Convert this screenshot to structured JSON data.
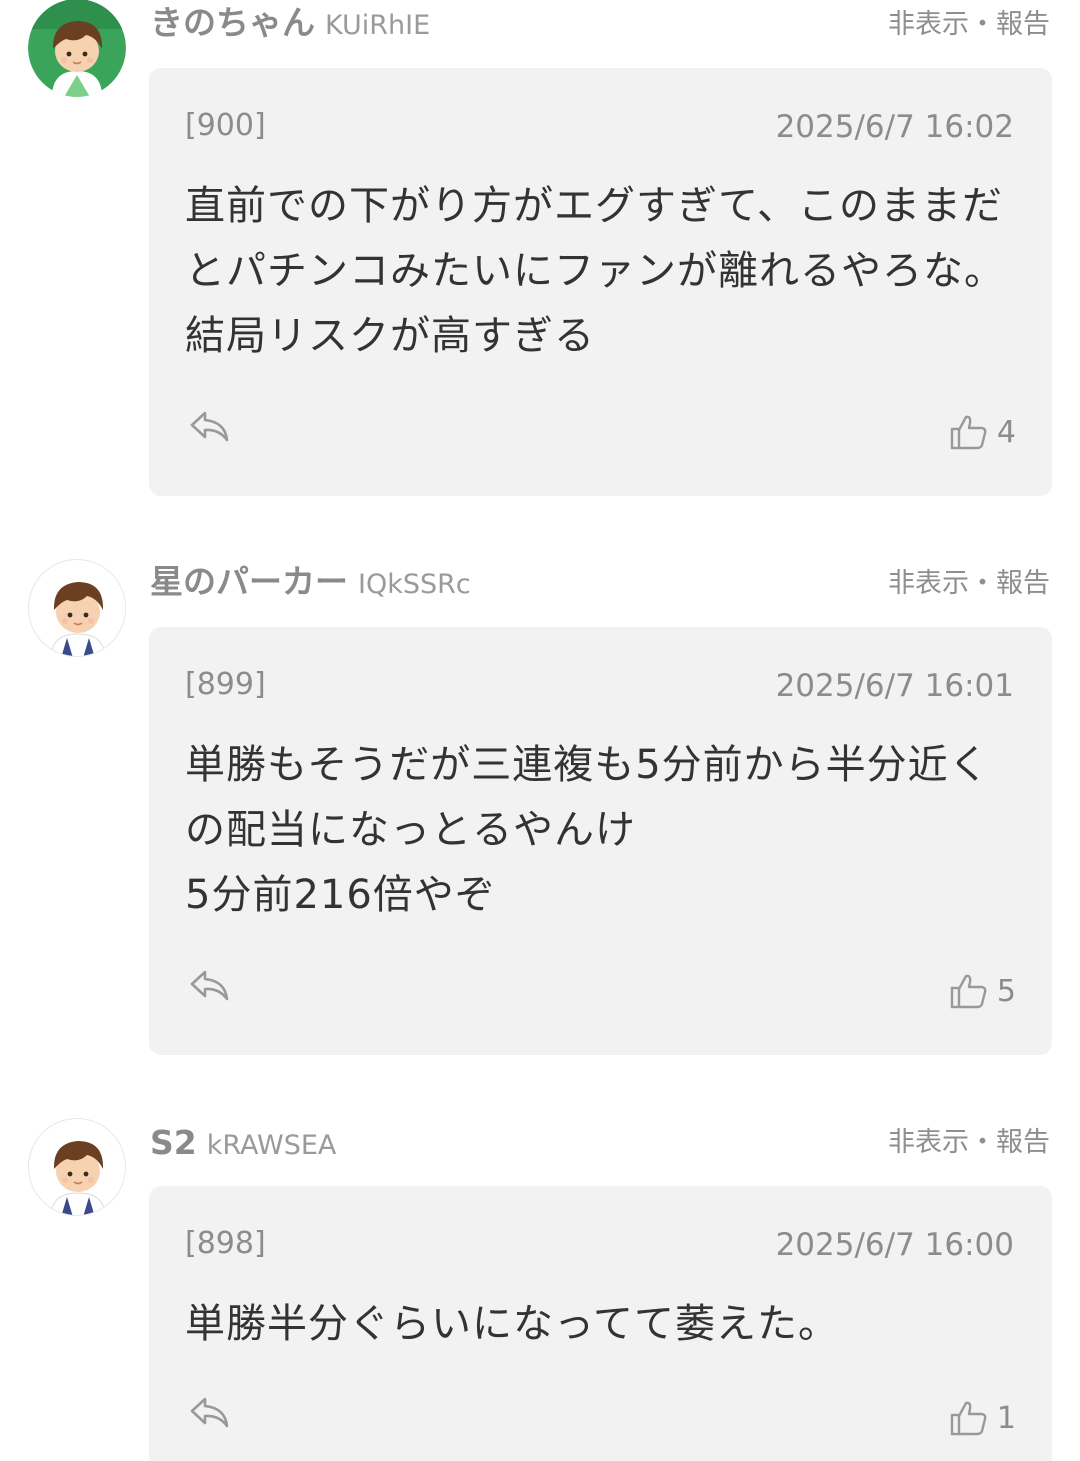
{
  "comments": [
    {
      "name": "きのちゃん",
      "uid": "KUiRhIE",
      "action": "非表示・報告",
      "number": "[900]",
      "date": "2025/6/7 16:02",
      "text": "直前での下がり方がエグすぎて、このままだとパチンコみたいにファンが離れるやろな。結局リスクが高すぎる",
      "likes": "4",
      "avatar_icon": "boy-avatar-icon-green-background"
    },
    {
      "name": "星のパーカー",
      "uid": "IQkSSRc",
      "action": "非表示・報告",
      "number": "[899]",
      "date": "2025/6/7 16:01",
      "text": "単勝もそうだが三連複も5分前から半分近くの配当になっとるやんけ\n5分前216倍やぞ",
      "likes": "5",
      "avatar_icon": "boy-avatar-icon"
    },
    {
      "name": "S2",
      "uid": "kRAWSEA",
      "action": "非表示・報告",
      "number": "[898]",
      "date": "2025/6/7 16:00",
      "text": "単勝半分ぐらいになってて萎えた。",
      "likes": "1",
      "avatar_icon": "boy-avatar-icon"
    }
  ],
  "icons": {
    "reply": "reply-arrow-icon",
    "like": "thumbs-up-icon"
  },
  "colors": {
    "card_background": "#f2f2f2",
    "muted_text": "#8c8c8c",
    "body_text": "#333333"
  }
}
